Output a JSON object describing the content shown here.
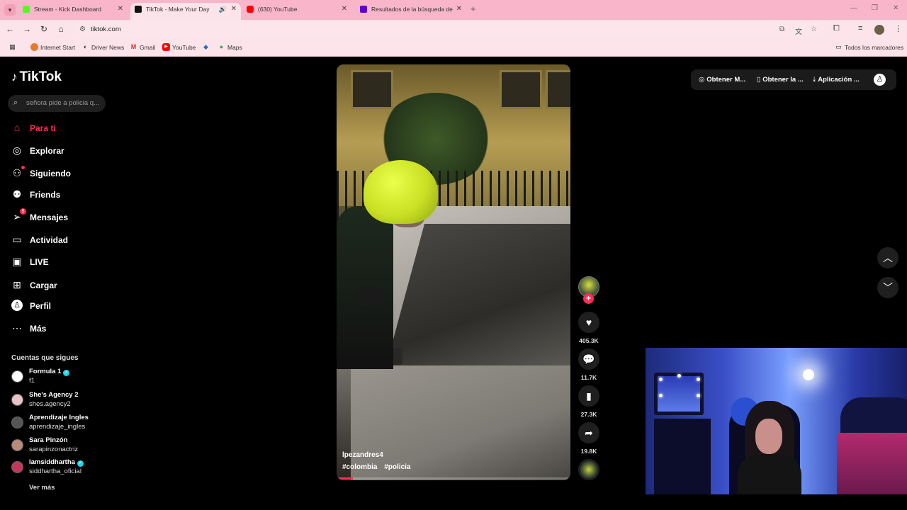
{
  "browser": {
    "tabs": [
      {
        "title": "Stream - Kick Dashboard",
        "icon_color": "#53fc18",
        "active": false
      },
      {
        "title": "TikTok - Make Your Day",
        "icon_color": "#111111",
        "active": true
      },
      {
        "title": "(630) YouTube",
        "icon_color": "#ff0000",
        "active": false
      },
      {
        "title": "Resultados de la búsqueda de",
        "icon_color": "#6001d2",
        "active": false
      }
    ],
    "url": "tiktok.com",
    "bookmarks": [
      {
        "label": "Internet Start",
        "icon": "globe-icon"
      },
      {
        "label": "Driver News",
        "icon": "news-icon"
      },
      {
        "label": "Gmail",
        "icon": "gmail-icon"
      },
      {
        "label": "YouTube",
        "icon": "youtube-icon"
      },
      {
        "label": "",
        "icon": "extension-icon"
      },
      {
        "label": "Maps",
        "icon": "maps-icon"
      }
    ],
    "all_bookmarks": "Todos los marcadores"
  },
  "tiktok": {
    "logo": "TikTok",
    "search_placeholder": "señora pide a policia q...",
    "nav": [
      {
        "label": "Para ti",
        "icon": "home-icon",
        "active": true
      },
      {
        "label": "Explorar",
        "icon": "compass-icon"
      },
      {
        "label": "Siguiendo",
        "icon": "following-icon"
      },
      {
        "label": "Friends",
        "icon": "friends-icon"
      },
      {
        "label": "Mensajes",
        "icon": "messages-icon",
        "badge": "5"
      },
      {
        "label": "Actividad",
        "icon": "activity-icon"
      },
      {
        "label": "LIVE",
        "icon": "live-icon"
      },
      {
        "label": "Cargar",
        "icon": "upload-icon"
      },
      {
        "label": "Perfil",
        "icon": "profile-icon"
      },
      {
        "label": "Más",
        "icon": "more-icon"
      }
    ],
    "following_title": "Cuentas que sigues",
    "following": [
      {
        "name": "Formula 1",
        "handle": "f1",
        "verified": true
      },
      {
        "name": "She's Agency 2",
        "handle": "shes.agency2",
        "verified": false
      },
      {
        "name": "Aprendizaje Ingles",
        "handle": "aprendizaje_ingles",
        "verified": false
      },
      {
        "name": "Sara Pinzón",
        "handle": "sarapinzonactriz",
        "verified": false
      },
      {
        "name": "Iamsiddhartha",
        "handle": "siddhartha_oficial",
        "verified": true
      }
    ],
    "see_more": "Ver más",
    "video": {
      "author": "lpezandres4",
      "tags": [
        "#colombia",
        "#policia"
      ],
      "progress": 0.07
    },
    "actions": {
      "likes": "405.3K",
      "comments": "11.7K",
      "saves": "27.3K",
      "shares": "19.8K"
    },
    "topbar": {
      "coins": "Obtener M...",
      "app": "Obtener la ...",
      "download": "Aplicación ..."
    }
  }
}
